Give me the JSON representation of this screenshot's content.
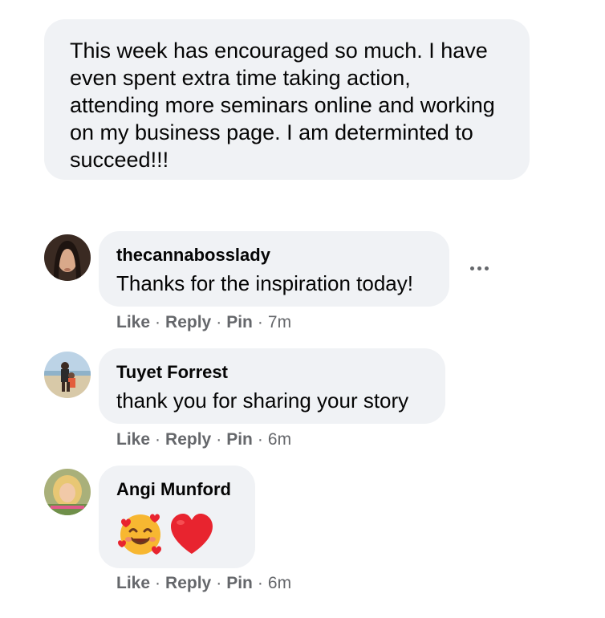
{
  "post": {
    "text": "This week has encouraged so much. I have even spent extra time taking action, attending more seminars online and working on my business page. I am determinted to succeed!!!"
  },
  "comments": [
    {
      "author": "thecannabosslady",
      "text": "Thanks for the inspiration today!",
      "actions": {
        "like": "Like",
        "reply": "Reply",
        "pin": "Pin",
        "time": "7m"
      },
      "avatar": "woman-portrait-dark-hair"
    },
    {
      "author": "Tuyet Forrest",
      "text": "thank you for sharing your story",
      "actions": {
        "like": "Like",
        "reply": "Reply",
        "pin": "Pin",
        "time": "6m"
      },
      "avatar": "beach-photo"
    },
    {
      "author": "Angi Munford",
      "text": "",
      "emojis": [
        "smiling-face-with-hearts-emoji",
        "red-heart-emoji"
      ],
      "actions": {
        "like": "Like",
        "reply": "Reply",
        "pin": "Pin",
        "time": "6m"
      },
      "avatar": "blonde-woman-portrait"
    }
  ],
  "more_options_icon": "ellipsis-icon",
  "colors": {
    "bubble": "#f0f2f5",
    "text": "#050505",
    "meta": "#65676b",
    "heart": "#e8242f",
    "emoji_face": "#f7b731"
  }
}
